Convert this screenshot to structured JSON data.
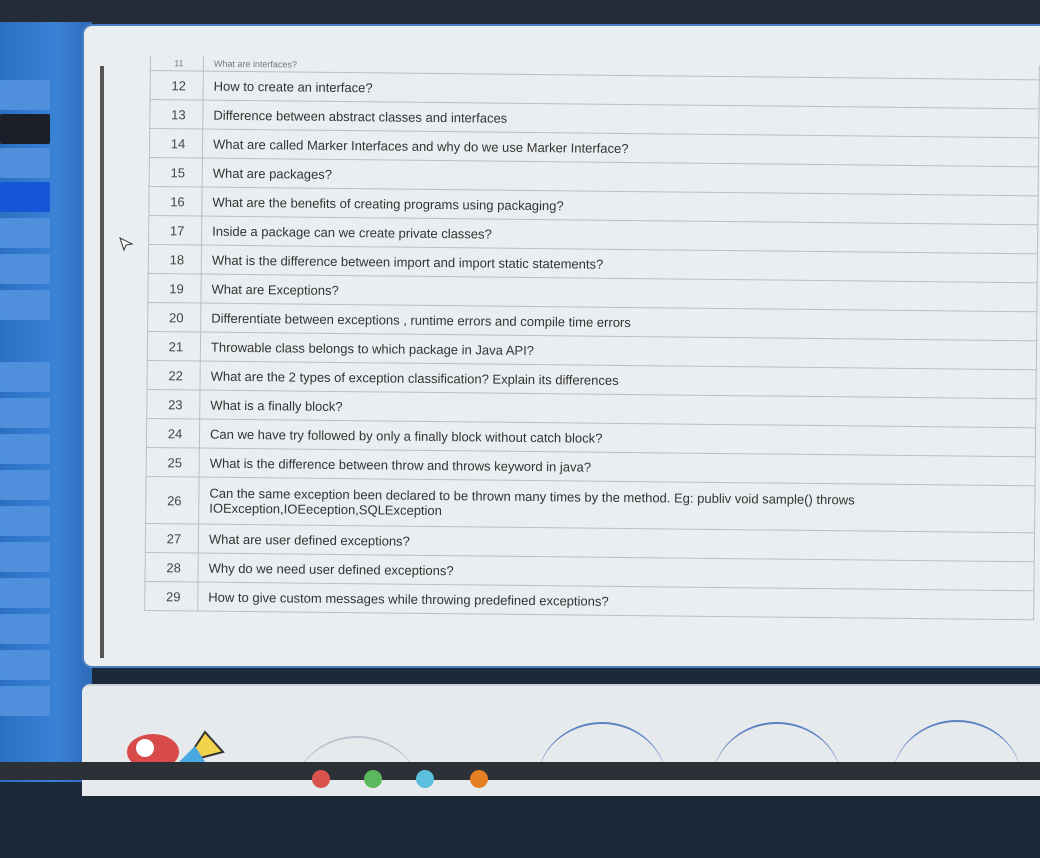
{
  "table": {
    "header_fragment": "What are interfaces?",
    "header_number": "11",
    "rows": [
      {
        "num": "12",
        "question": "How to create an interface?"
      },
      {
        "num": "13",
        "question": "Difference between abstract classes and interfaces"
      },
      {
        "num": "14",
        "question": "What are called Marker Interfaces and why do we use Marker Interface?"
      },
      {
        "num": "15",
        "question": "What are packages?"
      },
      {
        "num": "16",
        "question": "What are the benefits of creating programs using packaging?"
      },
      {
        "num": "17",
        "question": "Inside a package can we create private classes?"
      },
      {
        "num": "18",
        "question": "What is the difference between import and import static statements?"
      },
      {
        "num": "19",
        "question": "What are Exceptions?"
      },
      {
        "num": "20",
        "question": "Differentiate between exceptions , runtime errors and compile time errors"
      },
      {
        "num": "21",
        "question": "Throwable class belongs to which package in Java API?"
      },
      {
        "num": "22",
        "question": "What are the 2 types of exception classification? Explain its differences"
      },
      {
        "num": "23",
        "question": "What is a finally block?"
      },
      {
        "num": "24",
        "question": "Can we have try followed by only a finally block without catch block?"
      },
      {
        "num": "25",
        "question": "What is the difference between throw and throws keyword in java?"
      },
      {
        "num": "26",
        "question": "Can the same exception been declared to be thrown many times by the method. Eg: publiv void sample() throws IOException,IOEeception,SQLException"
      },
      {
        "num": "27",
        "question": "What are user defined exceptions?"
      },
      {
        "num": "28",
        "question": "Why do we need user defined exceptions?"
      },
      {
        "num": "29",
        "question": "How to give custom messages while throwing predefined exceptions?"
      }
    ]
  },
  "colors": {
    "sidebar_blue": "#2a6fc2",
    "screen_bg": "#eaeef0",
    "table_border": "#b9bfc5"
  }
}
